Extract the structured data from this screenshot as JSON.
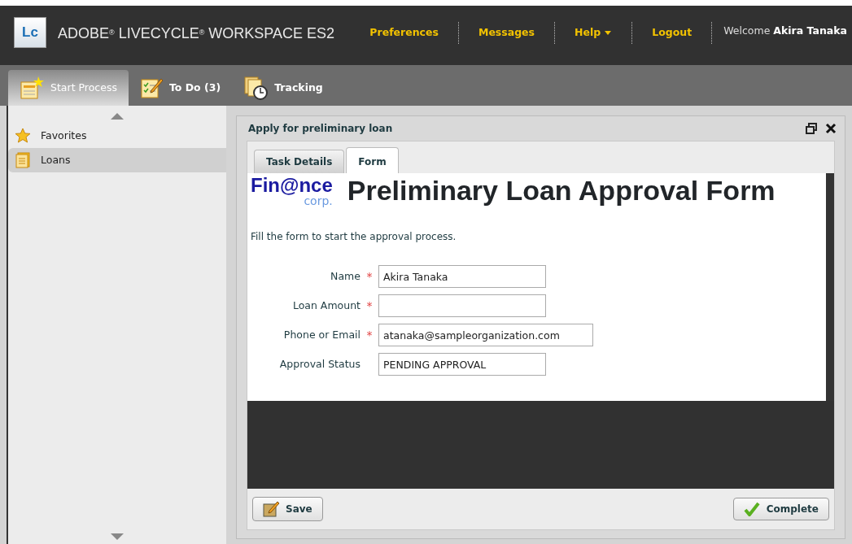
{
  "header": {
    "logo": "Lc",
    "title": "ADOBE$^{®}$ LIVECYCLE$^{®}$ WORKSPACE ES2",
    "links": [
      {
        "label": "Preferences",
        "dropdown": false
      },
      {
        "label": "Messages",
        "dropdown": false
      },
      {
        "label": "Help",
        "dropdown": true
      },
      {
        "label": "Logout",
        "dropdown": false
      }
    ],
    "welcome": "Welcome",
    "user": "Akira Tanaka"
  },
  "tabs": [
    {
      "label": "Start Process",
      "selected": true
    },
    {
      "label": "To Do (3)",
      "selected": false
    },
    {
      "label": "Tracking",
      "selected": false
    }
  ],
  "sidebar": {
    "items": [
      {
        "label": "Favorites",
        "selected": false
      },
      {
        "label": "Loans",
        "selected": true
      }
    ]
  },
  "panel": {
    "title": "Apply for preliminary loan",
    "tabs": [
      {
        "label": "Task Details",
        "selected": false
      },
      {
        "label": "Form",
        "selected": true
      }
    ],
    "form": {
      "logo": "Fin@nce",
      "logo_sub": "corp.",
      "heading": "Preliminary Loan Approval Form",
      "instructions": "Fill the form to start the approval process.",
      "fields": [
        {
          "label": "Name",
          "required_mark": "*",
          "value": "Akira Tanaka"
        },
        {
          "label": "Loan Amount",
          "required_mark": "*"
        },
        {
          "label": "Phone or Email",
          "required_mark": "*",
          "value": "atanaka@sampleorganization.com"
        },
        {
          "label": "Approval Status",
          "value": "PENDING APPROVAL"
        }
      ]
    },
    "buttons": [
      {
        "label": "Save",
        "kind": "save"
      },
      {
        "label": "Complete",
        "kind": "complete"
      }
    ]
  }
}
